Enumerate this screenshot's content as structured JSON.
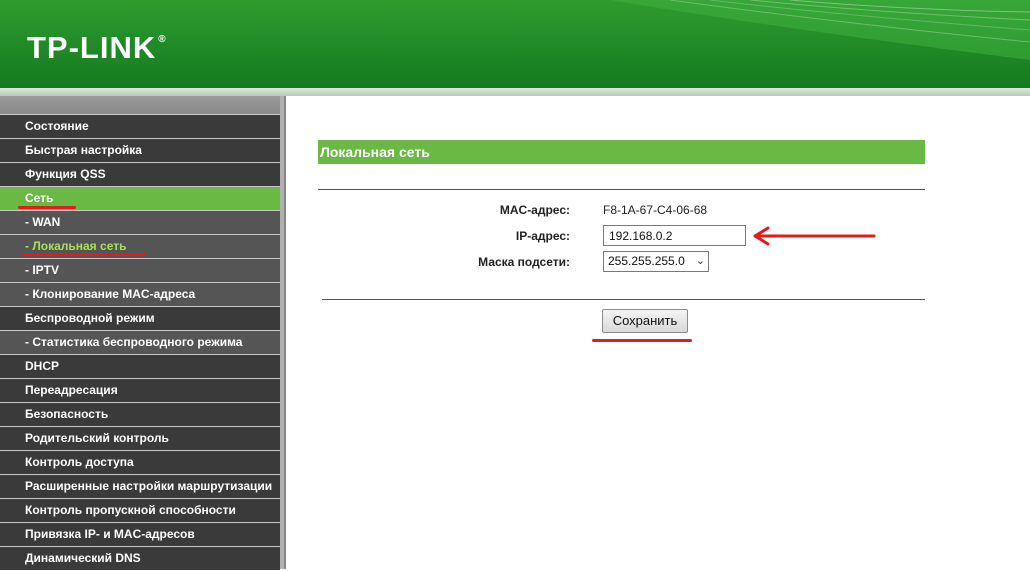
{
  "brand": {
    "logo_text": "TP-LINK",
    "trademark": "®"
  },
  "sidebar": {
    "items": [
      {
        "label": "Состояние",
        "type": "main"
      },
      {
        "label": "Быстрая настройка",
        "type": "main"
      },
      {
        "label": "Функция QSS",
        "type": "main"
      },
      {
        "label": "Сеть",
        "type": "active"
      },
      {
        "label": "- WAN",
        "type": "sub"
      },
      {
        "label": "- Локальная сеть",
        "type": "sub-selected"
      },
      {
        "label": "- IPTV",
        "type": "sub"
      },
      {
        "label": "- Клонирование MAC-адреса",
        "type": "sub"
      },
      {
        "label": "Беспроводной режим",
        "type": "main"
      },
      {
        "label": "- Статистика беспроводного режима",
        "type": "sub"
      },
      {
        "label": "DHCP",
        "type": "main"
      },
      {
        "label": "Переадресация",
        "type": "main"
      },
      {
        "label": "Безопасность",
        "type": "main"
      },
      {
        "label": "Родительский контроль",
        "type": "main"
      },
      {
        "label": "Контроль доступа",
        "type": "main"
      },
      {
        "label": "Расширенные настройки маршрутизации",
        "type": "main"
      },
      {
        "label": "Контроль пропускной способности",
        "type": "main"
      },
      {
        "label": "Привязка IP- и MAC-адресов",
        "type": "main"
      },
      {
        "label": "Динамический DNS",
        "type": "main"
      }
    ]
  },
  "main": {
    "section_title": "Локальная сеть",
    "mac": {
      "label": "MAC-адрес:",
      "value": "F8-1A-67-C4-06-68"
    },
    "ip": {
      "label": "IP-адрес:",
      "value": "192.168.0.2"
    },
    "mask": {
      "label": "Маска подсети:",
      "value": "255.255.255.0"
    },
    "save_label": "Сохранить"
  },
  "colors": {
    "header_green": "#1f8a26",
    "accent_green": "#6ab944",
    "menu_dark": "#3a3a3a",
    "annotation_red": "#e31b1b"
  }
}
